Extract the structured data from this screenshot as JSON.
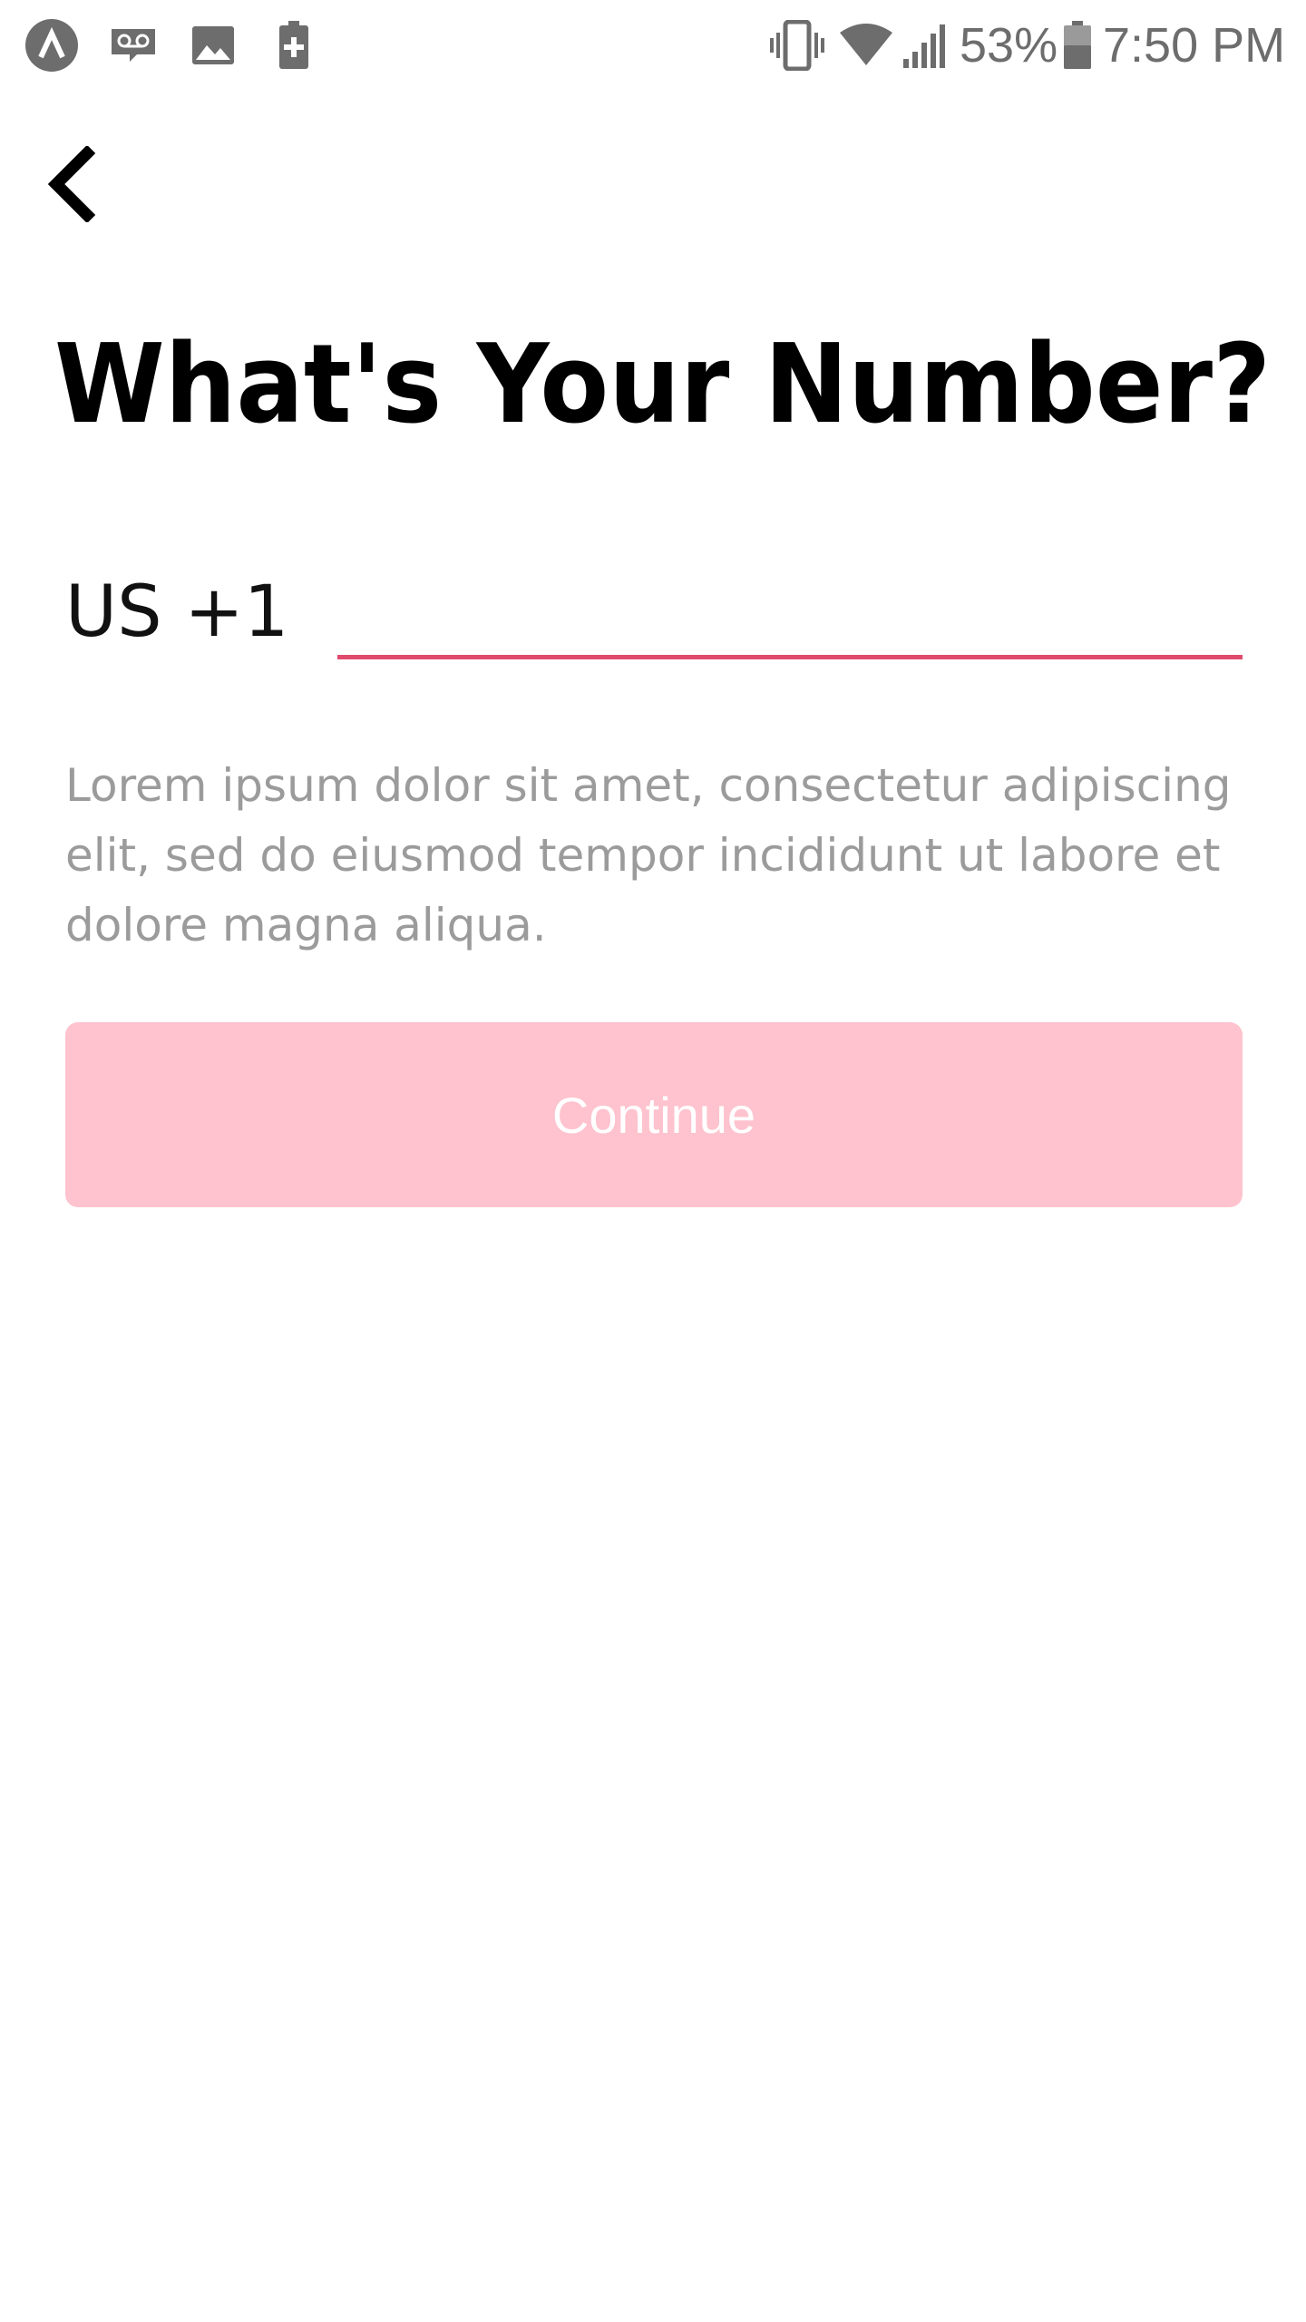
{
  "status_bar": {
    "icons": {
      "app_indicator": "arrow-logo-icon",
      "voicemail": "voicemail-icon",
      "image": "image-icon",
      "battery_saver": "battery-plus-icon",
      "vibrate": "vibrate-icon",
      "wifi": "wifi-icon",
      "signal": "signal-icon",
      "battery": "battery-icon"
    },
    "battery_percent": "53%",
    "time": "7:50 PM"
  },
  "back": {
    "icon": "chevron-left-icon"
  },
  "title": "What's Your Number?",
  "phone": {
    "country_code": "US +1",
    "value": "",
    "placeholder": ""
  },
  "description": "Lorem ipsum dolor sit amet, consectetur adipiscing elit, sed do eiusmod tempor incididunt ut labore et dolore magna aliqua.",
  "continue_label": "Continue",
  "colors": {
    "accent": "#e04a6c",
    "button_disabled_bg": "#fec3ce",
    "description_text": "#9b9b9b",
    "status_icons": "#6d6d6d"
  }
}
